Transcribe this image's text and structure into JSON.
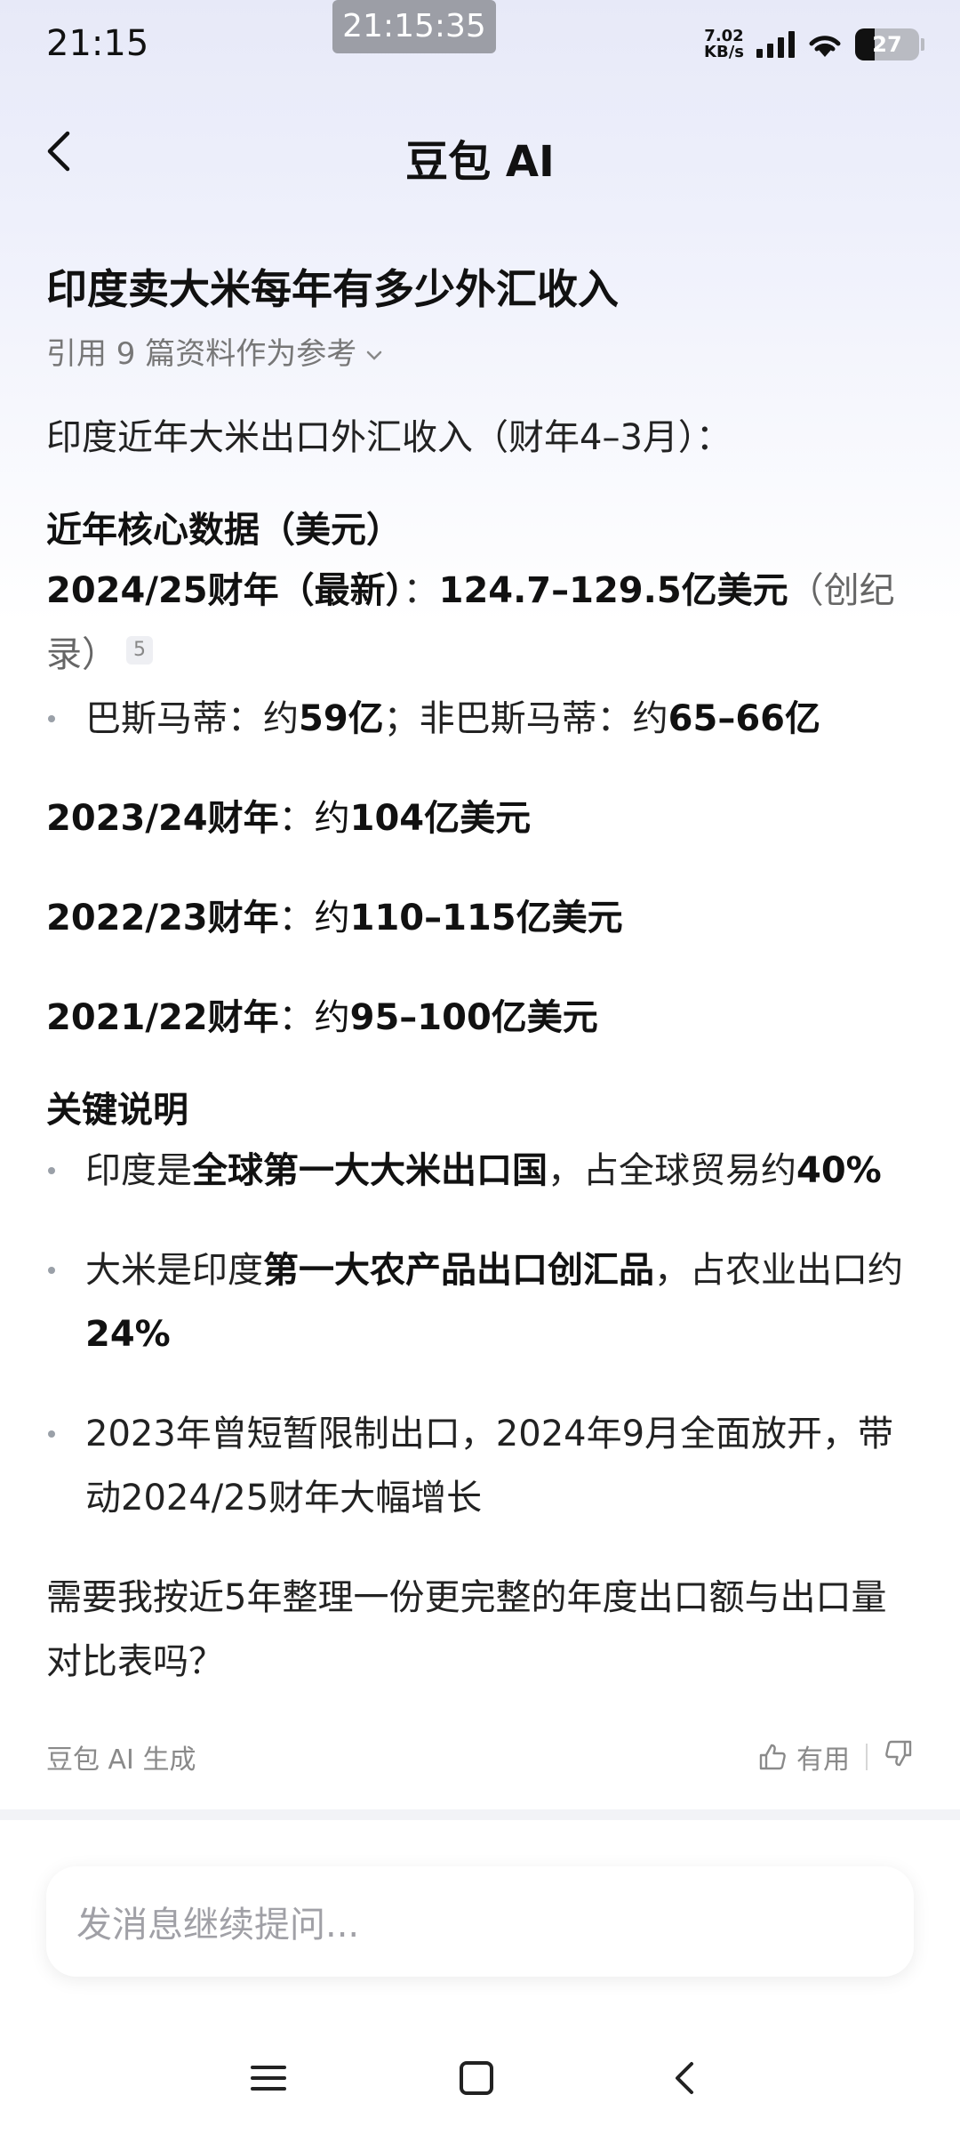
{
  "status_bar": {
    "time": "21:15",
    "recording_time": "21:15:35",
    "net_speed_value": "7.02",
    "net_speed_unit": "KB/s",
    "battery": "27"
  },
  "header": {
    "title": "豆包 AI"
  },
  "question": "印度卖大米每年有多少外汇收入",
  "references": "引用 9 篇资料作为参考",
  "answer": {
    "intro": "印度近年大米出口外汇收入（财年4–3月）：",
    "core_heading": "近年核心数据（美元）",
    "fy2425_label": "2024/25财年（最新）",
    "fy2425_sep": "：",
    "fy2425_value": "124.7–129.5亿美元",
    "fy2425_note": "（创纪录）",
    "fy2425_cite": "5",
    "basmati_label": "巴斯马蒂：约",
    "basmati_value": "59亿",
    "non_basmati_label": "；非巴斯马蒂：约",
    "non_basmati_value": "65–66亿",
    "years": [
      {
        "label": "2023/24财年",
        "sep": "：约",
        "value": "104亿美元"
      },
      {
        "label": "2022/23财年",
        "sep": "：约",
        "value": "110–115亿美元"
      },
      {
        "label": "2021/22财年",
        "sep": "：约",
        "value": "95–100亿美元"
      }
    ],
    "key_heading": "关键说明",
    "key1_pre": "印度是",
    "key1_bold": "全球第一大大米出口国",
    "key1_post": "，占全球贸易约",
    "key1_pct": "40%",
    "key2_pre": "大米是印度",
    "key2_bold": "第一大农产品出口创汇品",
    "key2_post": "，占农业出口约",
    "key2_pct": "24%",
    "key3": "2023年曾短暂限制出口，2024年9月全面放开，带动2024/25财年大幅增长",
    "followup": "需要我按近5年整理一份更完整的年度出口额与出口量对比表吗？"
  },
  "footer": {
    "generated_by": "豆包 AI 生成",
    "like_label": "有用"
  },
  "input": {
    "placeholder": "发消息继续提问..."
  }
}
